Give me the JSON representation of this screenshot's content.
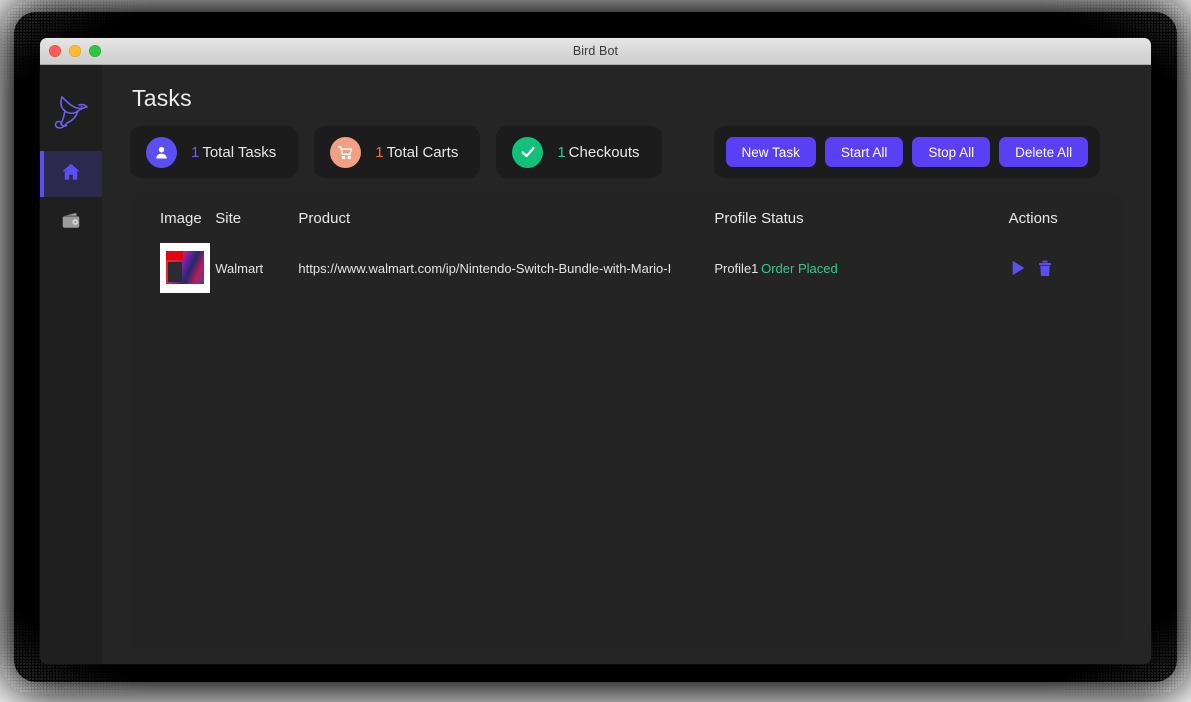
{
  "window": {
    "title": "Bird Bot",
    "traffic_lights": [
      "close-red",
      "minimize-yellow",
      "maximize-green"
    ]
  },
  "sidebar": {
    "logo": "bird-logo-icon",
    "items": [
      {
        "name": "home",
        "icon": "home-icon",
        "active": true
      },
      {
        "name": "wallet",
        "icon": "wallet-icon",
        "active": false
      }
    ]
  },
  "main": {
    "page_title": "Tasks",
    "stats": [
      {
        "icon": "person-icon",
        "count": "1",
        "label": "Total Tasks",
        "color": "#6b5cf5",
        "icon_bg": "#5b4ff2"
      },
      {
        "icon": "cart-icon",
        "count": "1",
        "label": "Total Carts",
        "color": "#e8732c",
        "icon_bg": "#f0a085"
      },
      {
        "icon": "check-icon",
        "count": "1",
        "label": "Checkouts",
        "color": "#2fcc8c",
        "icon_bg": "#13c07a"
      }
    ],
    "buttons": {
      "new_task": "New Task",
      "start_all": "Start All",
      "stop_all": "Stop All",
      "delete_all": "Delete All",
      "color": "#5b3ff5"
    },
    "table": {
      "headers": {
        "image": "Image",
        "site": "Site",
        "product": "Product",
        "profile": "Profile",
        "status": "Status",
        "actions": "Actions"
      },
      "rows": [
        {
          "image": "nintendo-switch-bundle-thumbnail",
          "site": "Walmart",
          "product": "https://www.walmart.com/ip/Nintendo-Switch-Bundle-with-Mario-I",
          "profile": "Profile1",
          "status": "Order Placed",
          "status_color": "#2fcc8c",
          "actions": [
            "start-play-icon",
            "delete-trash-icon"
          ]
        }
      ]
    }
  }
}
